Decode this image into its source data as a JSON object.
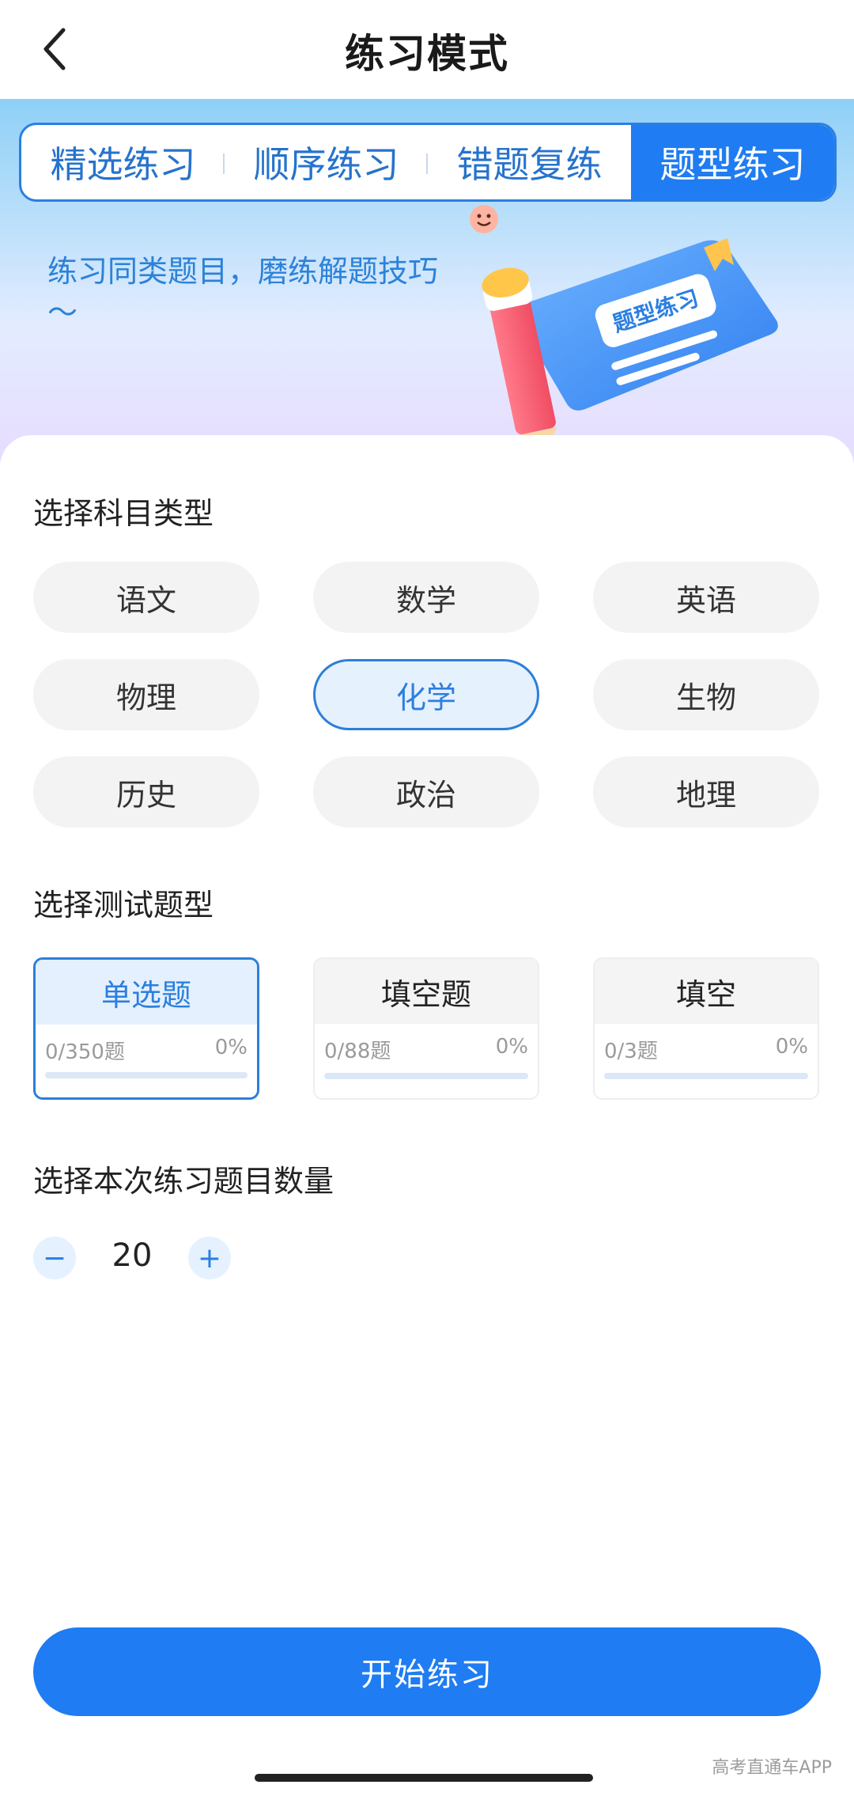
{
  "header": {
    "title": "练习模式",
    "back_icon": "chevron-left-icon"
  },
  "tabs": [
    {
      "label": "精选练习",
      "active": false
    },
    {
      "label": "顺序练习",
      "active": false
    },
    {
      "label": "错题复练",
      "active": false
    },
    {
      "label": "题型练习",
      "active": true
    }
  ],
  "banner": {
    "tagline": "练习同类题目，磨练解题技巧～",
    "book_label": "题型练习"
  },
  "subject_section": {
    "title": "选择科目类型",
    "subjects": [
      {
        "label": "语文",
        "selected": false
      },
      {
        "label": "数学",
        "selected": false
      },
      {
        "label": "英语",
        "selected": false
      },
      {
        "label": "物理",
        "selected": false
      },
      {
        "label": "化学",
        "selected": true
      },
      {
        "label": "生物",
        "selected": false
      },
      {
        "label": "历史",
        "selected": false
      },
      {
        "label": "政治",
        "selected": false
      },
      {
        "label": "地理",
        "selected": false
      }
    ]
  },
  "type_section": {
    "title": "选择测试题型",
    "types": [
      {
        "label": "单选题",
        "count": "0/350题",
        "percent": "0%",
        "progress": 0,
        "selected": true
      },
      {
        "label": "填空题",
        "count": "0/88题",
        "percent": "0%",
        "progress": 0,
        "selected": false
      },
      {
        "label": "填空",
        "count": "0/3题",
        "percent": "0%",
        "progress": 0,
        "selected": false
      }
    ]
  },
  "quantity_section": {
    "title": "选择本次练习题目数量",
    "minus_label": "−",
    "value": "20",
    "plus_label": "+"
  },
  "start_button": {
    "label": "开始练习"
  },
  "watermark": "高考直通车APP",
  "colors": {
    "accent": "#1f7cf2",
    "accent_text": "#2b7fe0",
    "chip_bg": "#f3f3f3",
    "chip_selected_bg": "#e6f1fe"
  }
}
